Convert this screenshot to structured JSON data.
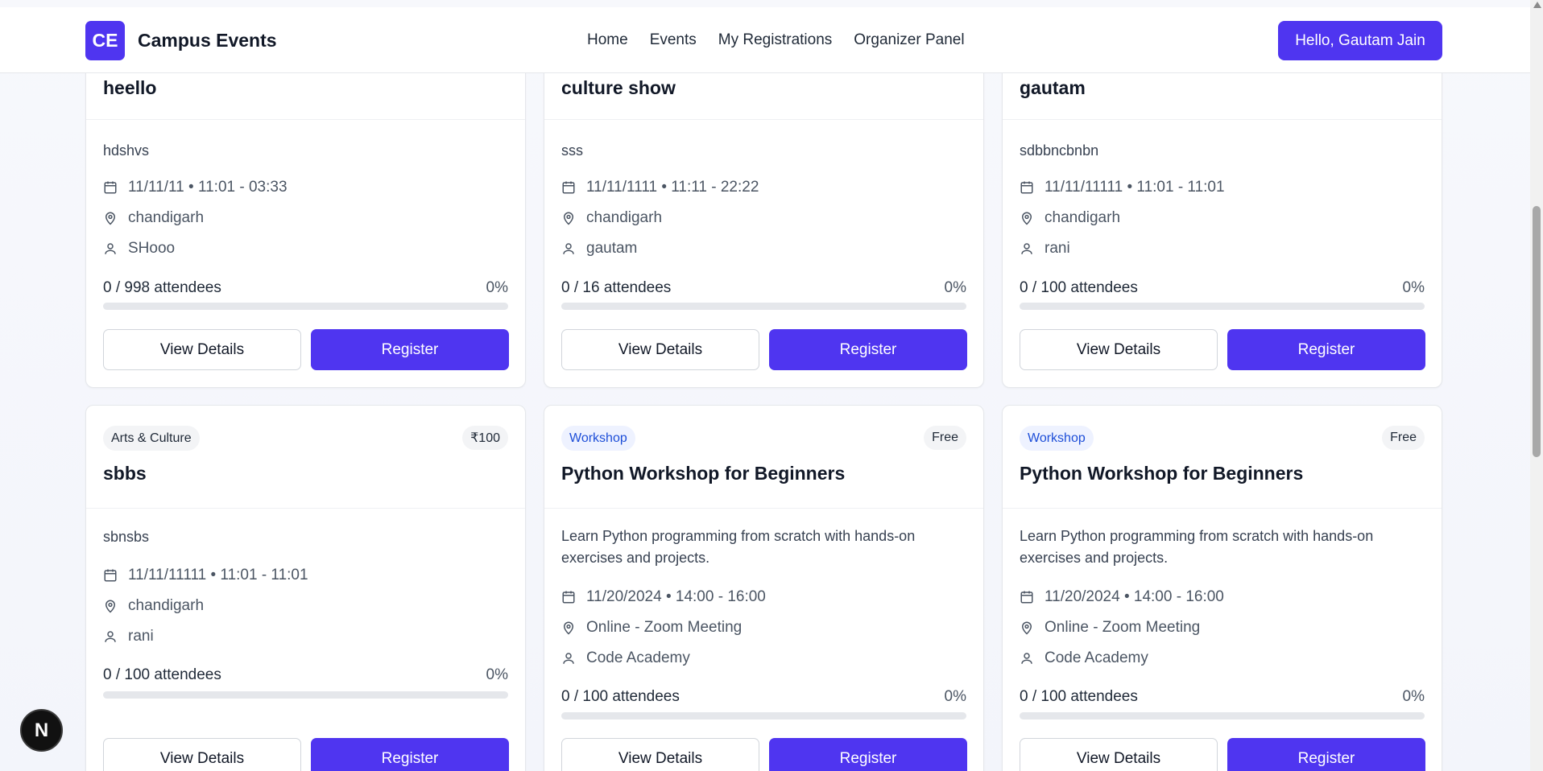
{
  "header": {
    "logo_text": "CE",
    "brand": "Campus Events",
    "nav": [
      "Home",
      "Events",
      "My Registrations",
      "Organizer Panel"
    ],
    "user_button": "Hello, Gautam Jain"
  },
  "labels": {
    "view_details": "View Details",
    "register": "Register"
  },
  "events": [
    {
      "title": "heello",
      "description": "hdshvs",
      "datetime": "11/11/11 • 11:01 - 03:33",
      "location": "chandigarh",
      "organizer": "SHooo",
      "attendees": "0 / 998 attendees",
      "percent": "0%"
    },
    {
      "title": "culture show",
      "description": "sss",
      "datetime": "11/11/1111 • 11:11 - 22:22",
      "location": "chandigarh",
      "organizer": "gautam",
      "attendees": "0 / 16 attendees",
      "percent": "0%"
    },
    {
      "title": "gautam",
      "description": "sdbbncbnbn",
      "datetime": "11/11/11111 • 11:01 - 11:01",
      "location": "chandigarh",
      "organizer": "rani",
      "attendees": "0 / 100 attendees",
      "percent": "0%"
    },
    {
      "category": "Arts & Culture",
      "price": "₹100",
      "title": "sbbs",
      "description": "sbnsbs",
      "datetime": "11/11/11111 • 11:01 - 11:01",
      "location": "chandigarh",
      "organizer": "rani",
      "attendees": "0 / 100 attendees",
      "percent": "0%"
    },
    {
      "category": "Workshop",
      "price": "Free",
      "title": "Python Workshop for Beginners",
      "description": "Learn Python programming from scratch with hands-on exercises and projects.",
      "datetime": "11/20/2024 • 14:00 - 16:00",
      "location": "Online - Zoom Meeting",
      "organizer": "Code Academy",
      "attendees": "0 / 100 attendees",
      "percent": "0%"
    },
    {
      "category": "Workshop",
      "price": "Free",
      "title": "Python Workshop for Beginners",
      "description": "Learn Python programming from scratch with hands-on exercises and projects.",
      "datetime": "11/20/2024 • 14:00 - 16:00",
      "location": "Online - Zoom Meeting",
      "organizer": "Code Academy",
      "attendees": "0 / 100 attendees",
      "percent": "0%"
    }
  ],
  "floating_badge": "N",
  "colors": {
    "accent": "#4f35f0",
    "workshop_badge_text": "#1d4ed8"
  }
}
